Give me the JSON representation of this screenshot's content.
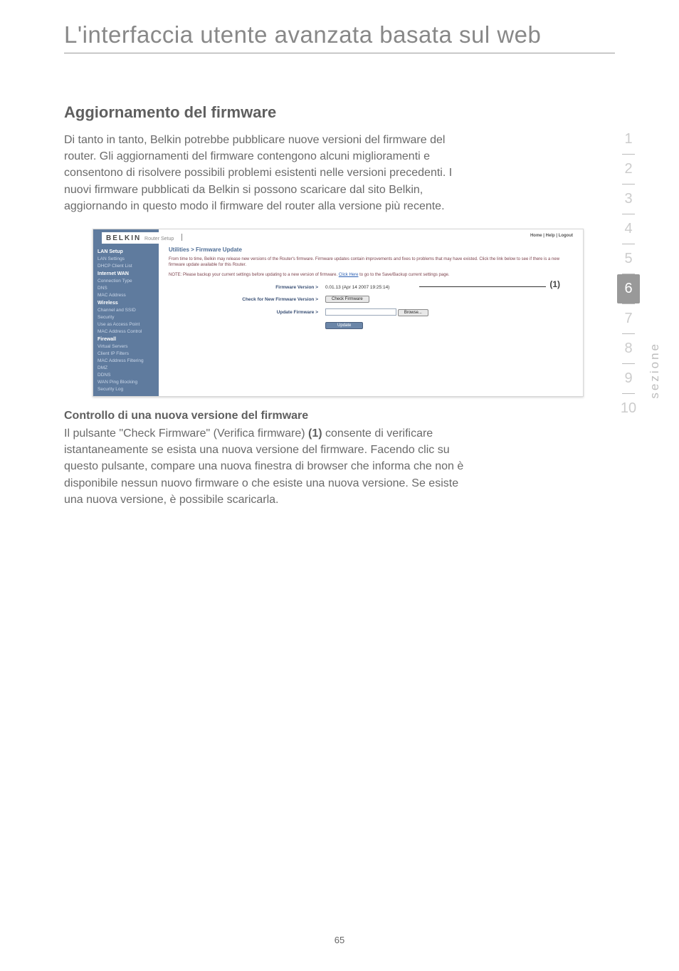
{
  "page_title": "L'interfaccia utente avanzata basata sul web",
  "section_heading": "Aggiornamento del firmware",
  "intro_paragraph": "Di tanto in tanto, Belkin potrebbe pubblicare nuove versioni del firmware del router. Gli aggiornamenti del firmware contengono alcuni miglioramenti e consentono di risolvere possibili problemi esistenti nelle versioni precedenti. I nuovi firmware pubblicati da Belkin si possono scaricare dal sito Belkin, aggiornando in questo modo il firmware del router alla versione più recente.",
  "sub_heading": "Controllo di una nuova versione del firmware",
  "sub_text_a": "Il pulsante \"Check Firmware\" (Verifica firmware) ",
  "sub_text_ref": "(1)",
  "sub_text_b": " consente di verificare istantaneamente se esista una nuova versione del firmware. Facendo clic su questo pulsante, compare una nuova finestra di browser che informa che non è disponibile nessun nuovo firmware o che esiste una nuova versione. Se esiste una nuova versione, è possibile scaricarla.",
  "side_nav": [
    "1",
    "2",
    "3",
    "4",
    "5",
    "6",
    "7",
    "8",
    "9",
    "10"
  ],
  "side_nav_active_index": 5,
  "vertical_label": "sezione",
  "page_number": "65",
  "screenshot": {
    "logo": "BELKIN",
    "logo_sub": "Router Setup",
    "header_links": "Home | Help | Logout",
    "title": "Utilities > Firmware Update",
    "desc1": "From time to time, Belkin may release new versions of the Router's firmware. Firmware updates contain improvements and fixes to problems that may have existed. Click the link below to see if there is a new firmware update available for this Router.",
    "note_a": "NOTE: Please backup your current settings before updating to a new version of firmware.",
    "note_link": "Click Here",
    "note_b": " to go to the Save/Backup current settings page.",
    "row_fw_version_lbl": "Firmware Version >",
    "row_fw_version_val": "0.01.13 (Apr 14 2007 19:25:14)",
    "row_check_lbl": "Check for New Firmware Version >",
    "row_check_btn": "Check Firmware",
    "row_update_lbl": "Update Firmware >",
    "row_browse_btn": "Browse...",
    "row_update_btn": "Update",
    "callout": "(1)",
    "sidebar": {
      "g1": "LAN Setup",
      "g1_items": [
        "LAN Settings",
        "DHCP Client List"
      ],
      "g2": "Internet WAN",
      "g2_items": [
        "Connection Type",
        "DNS",
        "MAC Address"
      ],
      "g3": "Wireless",
      "g3_items": [
        "Channel and SSID",
        "Security",
        "Use as Access Point",
        "MAC Address Control"
      ],
      "g4": "Firewall",
      "g4_items": [
        "Virtual Servers",
        "Client IP Filters",
        "MAC Address Filtering",
        "DMZ",
        "DDNS",
        "WAN Ping Blocking",
        "Security Log"
      ]
    }
  }
}
